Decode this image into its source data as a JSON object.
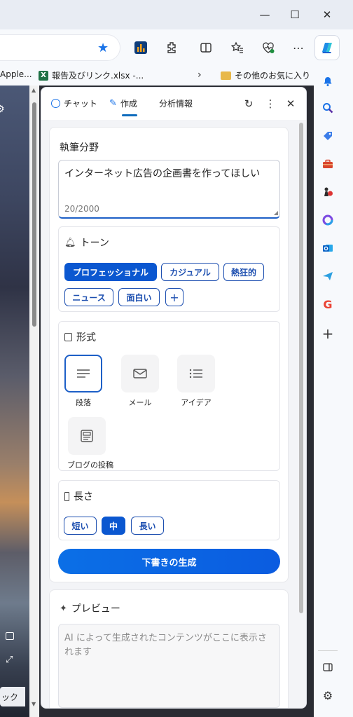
{
  "window": {
    "minimize": "—",
    "maximize": "☐",
    "close": "✕"
  },
  "favorites": [
    {
      "label": "Apple..."
    },
    {
      "label": "報告及びリンク.xlsx -..."
    }
  ],
  "favorites_other": "その他のお気に入り",
  "left_button": "ック",
  "pane": {
    "tabs": [
      {
        "label": "チャット"
      },
      {
        "label": "作成"
      },
      {
        "label": "分析情報"
      }
    ],
    "active_tab": "作成",
    "compose": {
      "title": "執筆分野",
      "input_value": "インターネット広告の企画書を作ってほしい",
      "char_count": "20/2000",
      "tone": {
        "title": "トーン",
        "options": [
          "プロフェッショナル",
          "カジュアル",
          "熱狂的",
          "ニュース",
          "面白い"
        ],
        "selected": "プロフェッショナル",
        "add": "+"
      },
      "format": {
        "title": "形式",
        "options": [
          "段落",
          "メール",
          "アイデア",
          "ブログの投稿"
        ],
        "selected": "段落"
      },
      "length": {
        "title": "長さ",
        "options": [
          "短い",
          "中",
          "長い"
        ],
        "selected": "中"
      },
      "generate": "下書きの生成"
    },
    "preview": {
      "title": "プレビュー",
      "placeholder": "AI によって生成されたコンテンツがここに表示されます"
    }
  },
  "colors": {
    "accent": "#0b57d0",
    "favorite_star": "#1a73e8"
  }
}
